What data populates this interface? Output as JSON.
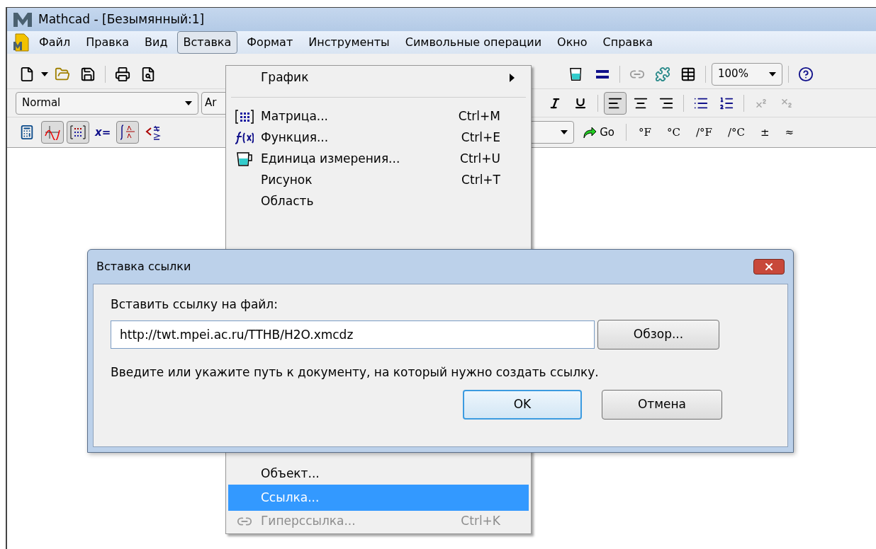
{
  "window": {
    "title": "Mathcad - [Безымянный:1]"
  },
  "menubar": [
    {
      "label": "Файл",
      "selected": false
    },
    {
      "label": "Правка",
      "selected": false
    },
    {
      "label": "Вид",
      "selected": false
    },
    {
      "label": "Вставка",
      "selected": true
    },
    {
      "label": "Формат",
      "selected": false
    },
    {
      "label": "Инструменты",
      "selected": false
    },
    {
      "label": "Символьные операции",
      "selected": false
    },
    {
      "label": "Окно",
      "selected": false
    },
    {
      "label": "Справка",
      "selected": false
    }
  ],
  "standard_toolbar": {
    "zoom": "100%"
  },
  "format_toolbar": {
    "style": "Normal",
    "font": "Ar",
    "align_buttons": [
      {
        "pressed": true
      },
      {
        "pressed": false
      },
      {
        "pressed": false
      }
    ]
  },
  "math_toolbar": {
    "buttons": [
      {
        "pressed": false
      },
      {
        "pressed": true
      },
      {
        "pressed": true
      },
      {
        "pressed": false
      },
      {
        "pressed": true
      },
      {
        "pressed": false
      }
    ],
    "eval_label": "x=",
    "go": "Go",
    "units": [
      "°F",
      "°C",
      "/°F",
      "/°C",
      "±",
      "≈"
    ]
  },
  "insert_menu": {
    "upper_items": [
      {
        "label": "График",
        "submenu": true,
        "selected": false,
        "disabled": false
      },
      {
        "kind": "separator"
      },
      {
        "label": "Матрица...",
        "shortcut": "Ctrl+M",
        "submenu": false,
        "selected": false,
        "disabled": false
      },
      {
        "label": "Функция...",
        "shortcut": "Ctrl+E",
        "submenu": false,
        "selected": false,
        "disabled": false
      },
      {
        "label": "Единица измерения...",
        "shortcut": "Ctrl+U",
        "submenu": false,
        "selected": false,
        "disabled": false
      },
      {
        "label": "Рисунок",
        "shortcut": "Ctrl+T",
        "submenu": false,
        "selected": false,
        "disabled": false
      },
      {
        "label": "Область",
        "submenu": false,
        "selected": false,
        "disabled": false
      }
    ],
    "lower_items": [
      {
        "label": "Объект...",
        "submenu": false,
        "selected": false,
        "disabled": false
      },
      {
        "label": "Ссылка...",
        "submenu": false,
        "selected": true,
        "disabled": false
      },
      {
        "label": "Гиперссылка...",
        "shortcut": "Ctrl+K",
        "submenu": false,
        "selected": false,
        "disabled": true
      }
    ]
  },
  "dialog": {
    "title": "Вставка ссылки",
    "field_label": "Вставить ссылку на файл:",
    "path_value": "http://twt.mpei.ac.ru/TTHB/H2O.xmcdz",
    "browse_button": "Обзор...",
    "hint": "Введите или укажите путь к документу, на который нужно создать ссылку.",
    "ok_button": "OK",
    "cancel_button": "Отмена"
  }
}
